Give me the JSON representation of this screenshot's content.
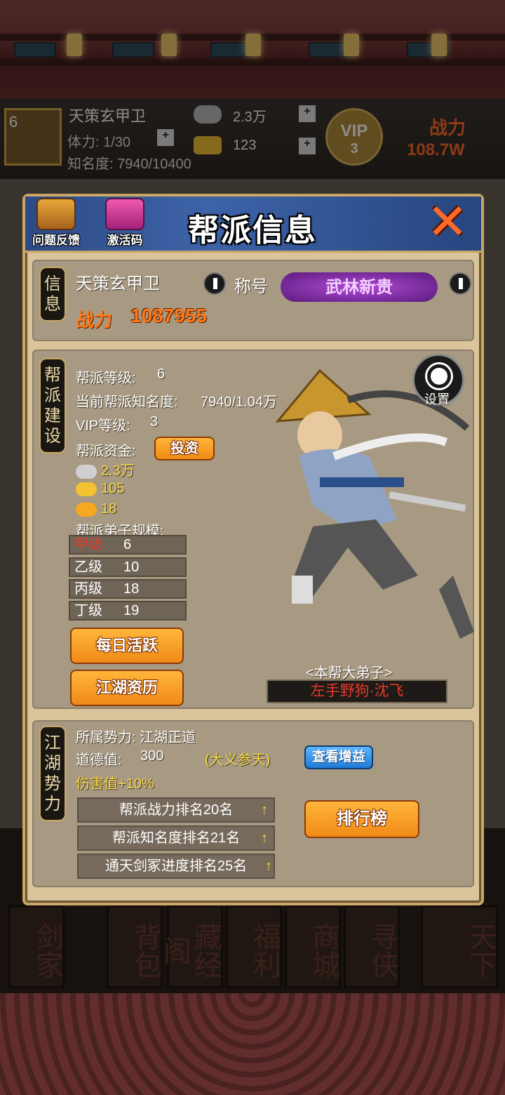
{
  "player": {
    "level": "6",
    "name": "天策玄甲卫",
    "stamina": "体力: 1/30",
    "fame": "知名度: 7940/10400",
    "silver": "2.3万",
    "gold": "123",
    "vip_label": "VIP",
    "vip_level": "3",
    "power_label": "战力",
    "power_value": "108.7W"
  },
  "panel": {
    "title": "帮派信息",
    "feedback_label": "问题反馈",
    "code_label": "激活码"
  },
  "info": {
    "tag": "信息",
    "guild_name": "天策玄甲卫",
    "title_label": "称号",
    "title_badge": "武林新贵",
    "power_label": "战力",
    "power_value": "1087955"
  },
  "build": {
    "tag": "帮派建设",
    "level_label": "帮派等级:",
    "level": "6",
    "fame_label": "当前帮派知名度:",
    "fame": "7940/1.04万",
    "vip_label": "VIP等级:",
    "vip": "3",
    "funds_label": "帮派资金:",
    "invest_btn": "投资",
    "silver": "2.3万",
    "gold": "105",
    "ingot": "18",
    "disciples_label": "帮派弟子规模:",
    "grades": [
      {
        "name": "甲级",
        "count": "6"
      },
      {
        "name": "乙级",
        "count": "10"
      },
      {
        "name": "丙级",
        "count": "18"
      },
      {
        "name": "丁级",
        "count": "19"
      }
    ],
    "daily_btn": "每日活跃",
    "history_btn": "江湖资历",
    "settings_label": "设置",
    "top_disciple_label": "<本帮大弟子>",
    "top_disciple_name": "左手野狗·沈飞"
  },
  "faction": {
    "tag": "江湖势力",
    "affiliation": "所属势力: 江湖正道",
    "morality_label": "道德值:",
    "morality": "300",
    "morality_rank": "(大义参天)",
    "view_bonus_btn": "查看增益",
    "damage": "伤害值+10%",
    "ranks": [
      "帮派战力排名20名",
      "帮派知名度排名21名",
      "通天剑冢进度排名25名"
    ],
    "leaderboard_btn": "排行榜"
  },
  "bottom_nav": [
    "剑家",
    "背包",
    "藏经阁",
    "福利",
    "商城",
    "寻侠",
    "天下"
  ],
  "colors": {
    "accent_orange": "#f08a16",
    "panel_bg": "#d9c49b",
    "header_blue": "#3d63a8",
    "red_text": "#e43a2a"
  }
}
